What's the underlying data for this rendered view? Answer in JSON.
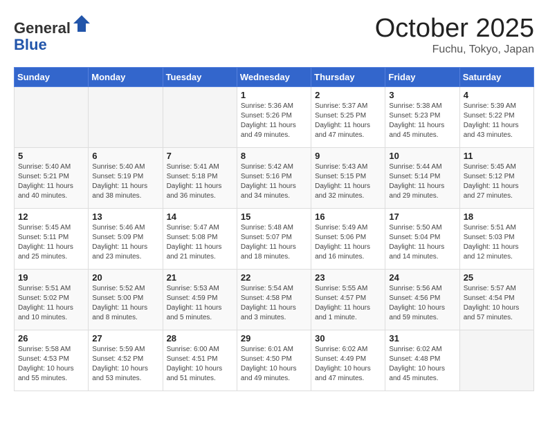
{
  "header": {
    "logo_general": "General",
    "logo_blue": "Blue",
    "month_title": "October 2025",
    "location": "Fuchu, Tokyo, Japan"
  },
  "weekdays": [
    "Sunday",
    "Monday",
    "Tuesday",
    "Wednesday",
    "Thursday",
    "Friday",
    "Saturday"
  ],
  "weeks": [
    [
      {
        "day": "",
        "info": ""
      },
      {
        "day": "",
        "info": ""
      },
      {
        "day": "",
        "info": ""
      },
      {
        "day": "1",
        "info": "Sunrise: 5:36 AM\nSunset: 5:26 PM\nDaylight: 11 hours\nand 49 minutes."
      },
      {
        "day": "2",
        "info": "Sunrise: 5:37 AM\nSunset: 5:25 PM\nDaylight: 11 hours\nand 47 minutes."
      },
      {
        "day": "3",
        "info": "Sunrise: 5:38 AM\nSunset: 5:23 PM\nDaylight: 11 hours\nand 45 minutes."
      },
      {
        "day": "4",
        "info": "Sunrise: 5:39 AM\nSunset: 5:22 PM\nDaylight: 11 hours\nand 43 minutes."
      }
    ],
    [
      {
        "day": "5",
        "info": "Sunrise: 5:40 AM\nSunset: 5:21 PM\nDaylight: 11 hours\nand 40 minutes."
      },
      {
        "day": "6",
        "info": "Sunrise: 5:40 AM\nSunset: 5:19 PM\nDaylight: 11 hours\nand 38 minutes."
      },
      {
        "day": "7",
        "info": "Sunrise: 5:41 AM\nSunset: 5:18 PM\nDaylight: 11 hours\nand 36 minutes."
      },
      {
        "day": "8",
        "info": "Sunrise: 5:42 AM\nSunset: 5:16 PM\nDaylight: 11 hours\nand 34 minutes."
      },
      {
        "day": "9",
        "info": "Sunrise: 5:43 AM\nSunset: 5:15 PM\nDaylight: 11 hours\nand 32 minutes."
      },
      {
        "day": "10",
        "info": "Sunrise: 5:44 AM\nSunset: 5:14 PM\nDaylight: 11 hours\nand 29 minutes."
      },
      {
        "day": "11",
        "info": "Sunrise: 5:45 AM\nSunset: 5:12 PM\nDaylight: 11 hours\nand 27 minutes."
      }
    ],
    [
      {
        "day": "12",
        "info": "Sunrise: 5:45 AM\nSunset: 5:11 PM\nDaylight: 11 hours\nand 25 minutes."
      },
      {
        "day": "13",
        "info": "Sunrise: 5:46 AM\nSunset: 5:09 PM\nDaylight: 11 hours\nand 23 minutes."
      },
      {
        "day": "14",
        "info": "Sunrise: 5:47 AM\nSunset: 5:08 PM\nDaylight: 11 hours\nand 21 minutes."
      },
      {
        "day": "15",
        "info": "Sunrise: 5:48 AM\nSunset: 5:07 PM\nDaylight: 11 hours\nand 18 minutes."
      },
      {
        "day": "16",
        "info": "Sunrise: 5:49 AM\nSunset: 5:06 PM\nDaylight: 11 hours\nand 16 minutes."
      },
      {
        "day": "17",
        "info": "Sunrise: 5:50 AM\nSunset: 5:04 PM\nDaylight: 11 hours\nand 14 minutes."
      },
      {
        "day": "18",
        "info": "Sunrise: 5:51 AM\nSunset: 5:03 PM\nDaylight: 11 hours\nand 12 minutes."
      }
    ],
    [
      {
        "day": "19",
        "info": "Sunrise: 5:51 AM\nSunset: 5:02 PM\nDaylight: 11 hours\nand 10 minutes."
      },
      {
        "day": "20",
        "info": "Sunrise: 5:52 AM\nSunset: 5:00 PM\nDaylight: 11 hours\nand 8 minutes."
      },
      {
        "day": "21",
        "info": "Sunrise: 5:53 AM\nSunset: 4:59 PM\nDaylight: 11 hours\nand 5 minutes."
      },
      {
        "day": "22",
        "info": "Sunrise: 5:54 AM\nSunset: 4:58 PM\nDaylight: 11 hours\nand 3 minutes."
      },
      {
        "day": "23",
        "info": "Sunrise: 5:55 AM\nSunset: 4:57 PM\nDaylight: 11 hours\nand 1 minute."
      },
      {
        "day": "24",
        "info": "Sunrise: 5:56 AM\nSunset: 4:56 PM\nDaylight: 10 hours\nand 59 minutes."
      },
      {
        "day": "25",
        "info": "Sunrise: 5:57 AM\nSunset: 4:54 PM\nDaylight: 10 hours\nand 57 minutes."
      }
    ],
    [
      {
        "day": "26",
        "info": "Sunrise: 5:58 AM\nSunset: 4:53 PM\nDaylight: 10 hours\nand 55 minutes."
      },
      {
        "day": "27",
        "info": "Sunrise: 5:59 AM\nSunset: 4:52 PM\nDaylight: 10 hours\nand 53 minutes."
      },
      {
        "day": "28",
        "info": "Sunrise: 6:00 AM\nSunset: 4:51 PM\nDaylight: 10 hours\nand 51 minutes."
      },
      {
        "day": "29",
        "info": "Sunrise: 6:01 AM\nSunset: 4:50 PM\nDaylight: 10 hours\nand 49 minutes."
      },
      {
        "day": "30",
        "info": "Sunrise: 6:02 AM\nSunset: 4:49 PM\nDaylight: 10 hours\nand 47 minutes."
      },
      {
        "day": "31",
        "info": "Sunrise: 6:02 AM\nSunset: 4:48 PM\nDaylight: 10 hours\nand 45 minutes."
      },
      {
        "day": "",
        "info": ""
      }
    ]
  ]
}
